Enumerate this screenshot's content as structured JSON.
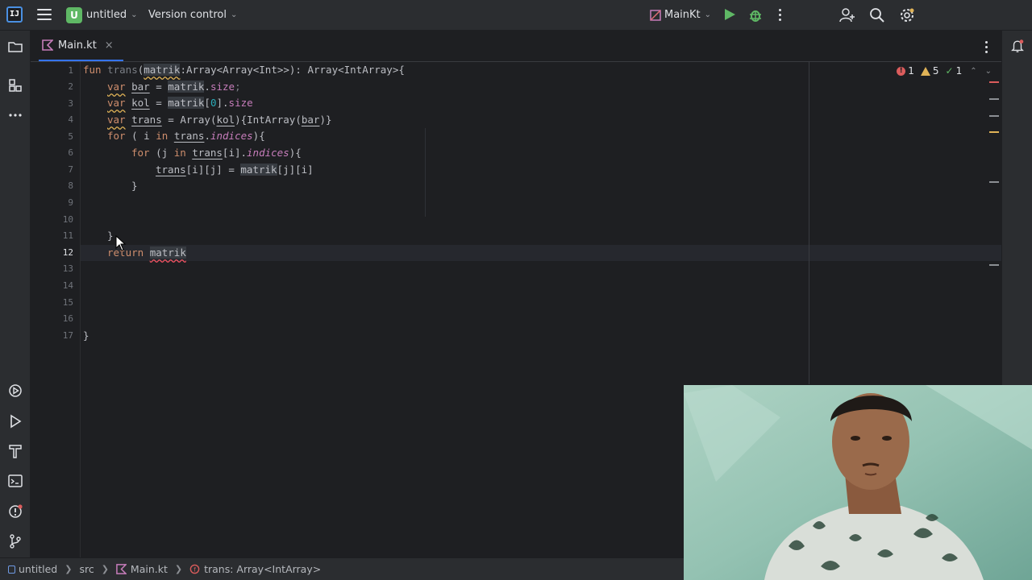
{
  "titlebar": {
    "project_badge": "U",
    "project_name": "untitled",
    "vcs": "Version control",
    "run_config": "MainKt"
  },
  "tab": {
    "label": "Main.kt",
    "close": "×"
  },
  "inspections": {
    "errors": "1",
    "warnings": "5",
    "weak_warnings": "1"
  },
  "gutter": {
    "line_numbers": [
      "1",
      "2",
      "3",
      "4",
      "5",
      "6",
      "7",
      "8",
      "9",
      "10",
      "11",
      "12",
      "13",
      "14",
      "15",
      "16",
      "17"
    ]
  },
  "code": {
    "l1": {
      "fun": "fun",
      "name": "trans",
      "p1": "(",
      "param": "matrik",
      "rest": ":Array<Array<Int>>): Array<IntArray>{"
    },
    "l2": {
      "var": "var",
      "sp1": " ",
      "name": "bar",
      "eq": " = ",
      "obj": "matrik",
      "dot": ".",
      "prop": "size",
      "semi": ";"
    },
    "l3": {
      "var": "var",
      "sp1": " ",
      "name": "kol",
      "eq": " = ",
      "obj": "matrik",
      "br1": "[",
      "num": "0",
      "br2": "].",
      "prop": "size"
    },
    "l4": {
      "var": "var",
      "sp1": " ",
      "name": "trans",
      "eq": " = Array(",
      "arg1": "kol",
      "mid": "){IntArray(",
      "arg2": "bar",
      "end": ")}"
    },
    "l5": {
      "for": "for",
      "a": " ( i ",
      "in": "in",
      "sp": " ",
      "obj": "trans",
      "dot": ".",
      "prop": "indices",
      "end": "){"
    },
    "l6": {
      "for": "for",
      "a": " (j ",
      "in": "in",
      "sp": " ",
      "obj": "trans",
      "idx": "[i].",
      "prop": "indices",
      "end": "){"
    },
    "l7": {
      "obj": "trans",
      "idx": "[i][j] = ",
      "obj2": "matrik",
      "idx2": "[j][i]"
    },
    "l8": {
      "text": "}"
    },
    "l11": {
      "text": "}"
    },
    "l12": {
      "ret": "return",
      "sp": " ",
      "name": "matrik"
    },
    "l17": {
      "text": "}"
    }
  },
  "statusbar": {
    "project": "untitled",
    "src": "src",
    "file": "Main.kt",
    "symbol": "trans: Array<IntArray>"
  },
  "colors": {
    "accent": "#3574f0",
    "run_green": "#5fb865",
    "error": "#db5c5c",
    "warning": "#e0b357"
  }
}
